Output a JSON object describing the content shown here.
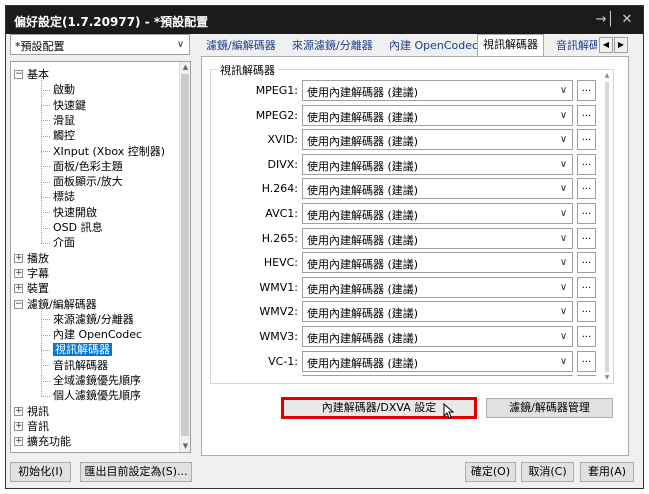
{
  "window": {
    "title": "偏好設定(1.7.20977) - *預設配置",
    "pin_icon": "pin-icon",
    "close_icon": "close-icon"
  },
  "preset": {
    "value": "*預設配置"
  },
  "tree": [
    {
      "label": "基本",
      "level": 0,
      "expander": "−"
    },
    {
      "label": "啟動",
      "level": 1
    },
    {
      "label": "快速鍵",
      "level": 1
    },
    {
      "label": "滑鼠",
      "level": 1
    },
    {
      "label": "觸控",
      "level": 1
    },
    {
      "label": "XInput (Xbox 控制器)",
      "level": 1
    },
    {
      "label": "面板/色彩主題",
      "level": 1
    },
    {
      "label": "面板顯示/放大",
      "level": 1
    },
    {
      "label": "標誌",
      "level": 1
    },
    {
      "label": "快速開啟",
      "level": 1
    },
    {
      "label": "OSD 訊息",
      "level": 1
    },
    {
      "label": "介面",
      "level": 1
    },
    {
      "label": "播放",
      "level": 0,
      "expander": "+"
    },
    {
      "label": "字幕",
      "level": 0,
      "expander": "+"
    },
    {
      "label": "裝置",
      "level": 0,
      "expander": "+"
    },
    {
      "label": "濾鏡/編解碼器",
      "level": 0,
      "expander": "−"
    },
    {
      "label": "來源濾鏡/分離器",
      "level": 1
    },
    {
      "label": "內建 OpenCodec",
      "level": 1
    },
    {
      "label": "視訊解碼器",
      "level": 1,
      "selected": true
    },
    {
      "label": "音訊解碼器",
      "level": 1
    },
    {
      "label": "全域濾鏡優先順序",
      "level": 1
    },
    {
      "label": "個人濾鏡優先順序",
      "level": 1
    },
    {
      "label": "視訊",
      "level": 0,
      "expander": "+"
    },
    {
      "label": "音訊",
      "level": 0,
      "expander": "+"
    },
    {
      "label": "擴充功能",
      "level": 0,
      "expander": "+"
    }
  ],
  "tabs": [
    {
      "label": "濾鏡/編解碼器",
      "active": false
    },
    {
      "label": "來源濾鏡/分離器",
      "active": false
    },
    {
      "label": "內建 OpenCodec",
      "active": false
    },
    {
      "label": "視訊解碼器",
      "active": true
    },
    {
      "label": "音訊解碼器",
      "active": false
    }
  ],
  "group_label": "視訊解碼器",
  "decoders": [
    {
      "codec": "MPEG1:",
      "value": "使用內建解碼器 (建議)"
    },
    {
      "codec": "MPEG2:",
      "value": "使用內建解碼器 (建議)"
    },
    {
      "codec": "XVID:",
      "value": "使用內建解碼器 (建議)"
    },
    {
      "codec": "DIVX:",
      "value": "使用內建解碼器 (建議)"
    },
    {
      "codec": "H.264:",
      "value": "使用內建解碼器 (建議)"
    },
    {
      "codec": "AVC1:",
      "value": "使用內建解碼器 (建議)"
    },
    {
      "codec": "H.265:",
      "value": "使用內建解碼器 (建議)"
    },
    {
      "codec": "HEVC:",
      "value": "使用內建解碼器 (建議)"
    },
    {
      "codec": "WMV1:",
      "value": "使用內建解碼器 (建議)"
    },
    {
      "codec": "WMV2:",
      "value": "使用內建解碼器 (建議)"
    },
    {
      "codec": "WMV3:",
      "value": "使用內建解碼器 (建議)"
    },
    {
      "codec": "VC-1:",
      "value": "使用內建解碼器 (建議)"
    },
    {
      "codec": "",
      "value": ""
    }
  ],
  "more_label": "...",
  "buttons": {
    "dxva": "內建解碼器/DXVA 設定",
    "filter_mgr": "濾鏡/解碼器管理",
    "reset": "初始化(I)",
    "export": "匯出目前設定為(S)...",
    "ok": "確定(O)",
    "cancel": "取消(C)",
    "apply": "套用(A)"
  },
  "colors": {
    "selection": "#0078d7",
    "highlight_box": "#e00000",
    "titlebar": "#1b1b1b"
  }
}
